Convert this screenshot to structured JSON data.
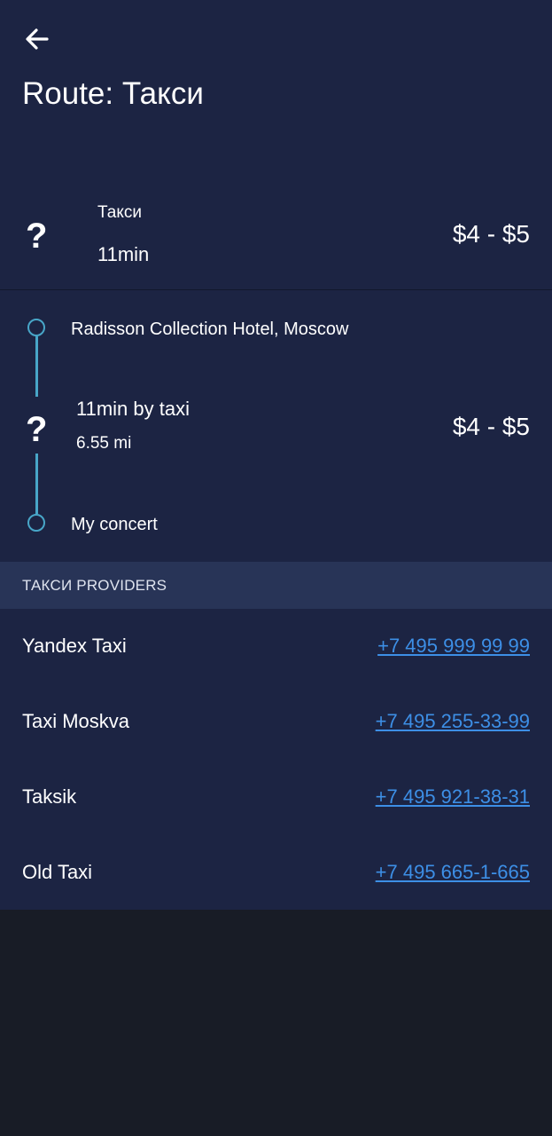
{
  "header": {
    "back_icon": "arrow-left-icon",
    "title": "Route: Такси"
  },
  "summary": {
    "icon_glyph": "?",
    "mode": "Такси",
    "duration": "11min",
    "price": "$4 - $5"
  },
  "route": {
    "origin": "Radisson Collection Hotel, Moscow",
    "destination": "My concert",
    "segment": {
      "icon_glyph": "?",
      "title": "11min by taxi",
      "distance": "6.55 mi",
      "price": "$4 - $5"
    },
    "line_color": "#48a6c8"
  },
  "providers": {
    "header": "ТАКСИ PROVIDERS",
    "items": [
      {
        "name": "Yandex Taxi",
        "phone": "+7 495 999 99 99"
      },
      {
        "name": "Taxi Moskva",
        "phone": "+7 495 255-33-99"
      },
      {
        "name": "Taksik",
        "phone": "+7 495 921-38-31"
      },
      {
        "name": "Old Taxi",
        "phone": "+7 495 665-1-665"
      }
    ]
  },
  "colors": {
    "background": "#1c2443",
    "section_header": "#283457",
    "link": "#3d8fe6",
    "empty_area": "#181c26"
  }
}
